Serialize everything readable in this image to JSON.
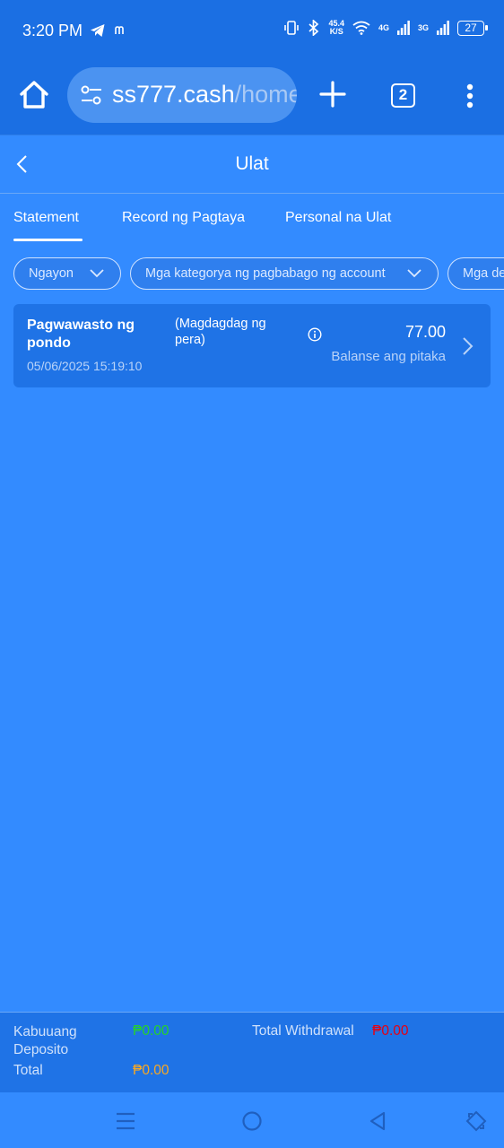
{
  "status_bar": {
    "time": "3:20 PM",
    "speed_value": "45.4",
    "speed_unit": "K/S",
    "network_1": "4G",
    "network_2": "3G",
    "battery": "27",
    "icons": [
      "telegram-icon",
      "notification-m-icon",
      "vibrate-icon",
      "bluetooth-icon",
      "wifi-icon",
      "signal-icon",
      "battery-icon"
    ]
  },
  "browser": {
    "url_host": "ss777.cash",
    "url_path": "/home",
    "tab_count": "2"
  },
  "page": {
    "title": "Ulat"
  },
  "tabs": [
    {
      "label": "Statement",
      "active": true
    },
    {
      "label": "Record ng Pagtaya",
      "active": false
    },
    {
      "label": "Personal na Ulat",
      "active": false
    }
  ],
  "filters": [
    {
      "label": "Ngayon"
    },
    {
      "label": "Mga kategorya ng pagbabago ng account"
    },
    {
      "label": "Mga de"
    }
  ],
  "transactions": [
    {
      "type": "Pagwawasto ng pondo",
      "date": "05/06/2025 15:19:10",
      "note": "(Magdagdag ng pera)",
      "amount": "77.00",
      "balance_label": "Balanse ang pitaka"
    }
  ],
  "totals": {
    "deposit_label": "Kabuuang Deposito",
    "deposit_value": "₱0.00",
    "withdrawal_label": "Total Withdrawal",
    "withdrawal_value": "₱0.00",
    "total_label": "Total",
    "total_value": "₱0.00",
    "colors": {
      "deposit": "#25d32a",
      "withdrawal": "#e60012",
      "total": "#f7a823"
    }
  },
  "nav": {
    "icons": [
      "recents-icon",
      "home-circle-icon",
      "back-triangle-icon",
      "rotate-icon"
    ]
  },
  "colors": {
    "background": "#338bff",
    "bar": "#1b6fe3",
    "card": "#1f73e6"
  }
}
